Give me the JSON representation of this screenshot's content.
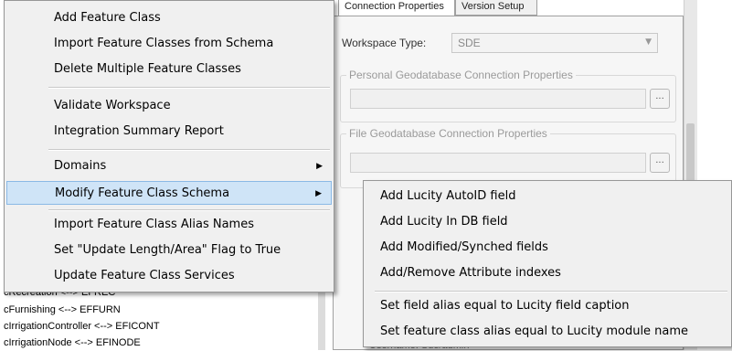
{
  "tree": {
    "items": [
      "cRecreation <--> EFREC",
      "cFurnishing <--> EFFURN",
      "cIrrigationController <--> EFICONT",
      "cIrrigationNode <--> EFINODE"
    ]
  },
  "tabs": {
    "connection_label": "Connection Properties",
    "version_label": "Version Setup"
  },
  "workspace": {
    "label": "Workspace Type:",
    "value": "SDE"
  },
  "groups": {
    "personal_title": "Personal Geodatabase Connection Properties",
    "file_title": "File Geodatabase Connection Properties",
    "browse_label": "..."
  },
  "underlying": {
    "text": "Username:  Sde/admin"
  },
  "main_menu": {
    "items": [
      {
        "label": "Add Feature Class"
      },
      {
        "label": "Import Feature Classes from Schema"
      },
      {
        "label": "Delete Multiple Feature Classes"
      },
      {
        "label": "Validate Workspace"
      },
      {
        "label": "Integration Summary Report"
      },
      {
        "label": "Domains"
      },
      {
        "label": "Modify Feature Class Schema"
      },
      {
        "label": "Import Feature Class Alias Names"
      },
      {
        "label": "Set \"Update Length/Area\" Flag to True"
      },
      {
        "label": "Update Feature Class Services"
      }
    ],
    "submenu_arrow": "▶"
  },
  "sub_menu": {
    "items": [
      {
        "label": "Add Lucity AutoID field"
      },
      {
        "label": "Add Lucity In DB field"
      },
      {
        "label": "Add Modified/Synched fields"
      },
      {
        "label": "Add/Remove Attribute indexes"
      },
      {
        "label": "Set field alias equal to Lucity field caption"
      },
      {
        "label": "Set feature class alias equal to Lucity module name"
      }
    ]
  },
  "colors": {
    "menu_bg": "#f0f0f0",
    "highlight": "#cfe4f7",
    "highlight_border": "#8ab9e6"
  },
  "icons": {
    "submenu": "chevron-right-icon",
    "combo": "chevron-down-icon"
  }
}
